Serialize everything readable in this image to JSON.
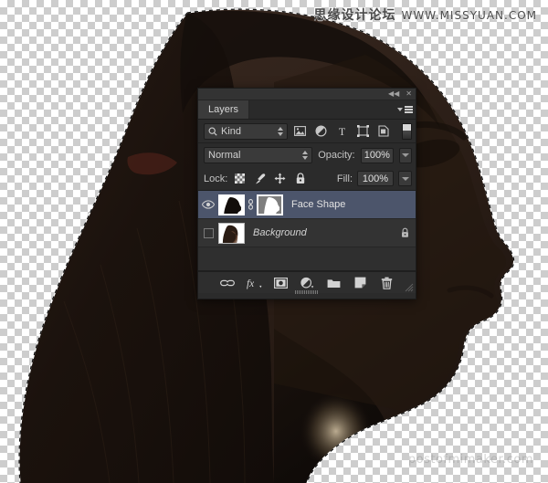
{
  "watermarks": {
    "top": "思缘设计论坛  WWW.MISSYUAN.COM",
    "top_cn": "思缘设计论坛",
    "top_url": "WWW.MISSYUAN.COM",
    "bottom": "postofmimaker.com"
  },
  "panel": {
    "titlebar": {
      "collapse_icon": "collapse-double-arrow",
      "collapse_glyph": "◀◀",
      "close_icon": "close-x",
      "close_glyph": "✕"
    },
    "tab": {
      "label": "Layers",
      "menu_icon": "panel-menu"
    },
    "filter_row": {
      "kind_label": "Kind",
      "search_icon": "magnifier-icon",
      "icons": [
        {
          "name": "filter-pixel-layers-icon",
          "title": "Pixel Layers"
        },
        {
          "name": "filter-adjustment-layers-icon",
          "title": "Adjustment Layers"
        },
        {
          "name": "filter-type-layers-icon",
          "title": "Type Layers",
          "glyph": "T"
        },
        {
          "name": "filter-shape-layers-icon",
          "title": "Shape Layers"
        },
        {
          "name": "filter-smart-objects-icon",
          "title": "Smart Objects"
        }
      ],
      "toggle_name": "filter-enable-toggle"
    },
    "blend_row": {
      "blend_mode": "Normal",
      "opacity_label": "Opacity:",
      "opacity_value": "100%"
    },
    "lock_row": {
      "lock_label": "Lock:",
      "fill_label": "Fill:",
      "fill_value": "100%",
      "lock_icons": [
        {
          "name": "lock-transparent-pixels-icon",
          "title": "Lock transparent pixels"
        },
        {
          "name": "lock-image-pixels-icon",
          "title": "Lock image pixels"
        },
        {
          "name": "lock-position-icon",
          "title": "Lock position"
        },
        {
          "name": "lock-all-icon",
          "title": "Lock all"
        }
      ]
    },
    "layers": [
      {
        "name": "Face Shape",
        "visible": true,
        "selected": true,
        "italic": false,
        "locked": false,
        "has_mask": true,
        "linked": true
      },
      {
        "name": "Background",
        "visible": false,
        "selected": false,
        "italic": true,
        "locked": true,
        "has_mask": false,
        "linked": false
      }
    ],
    "bottom_toolbar": [
      {
        "name": "link-layers-icon",
        "title": "Link layers"
      },
      {
        "name": "layer-style-fx-icon",
        "title": "Add a layer style",
        "glyph": "fx"
      },
      {
        "name": "add-layer-mask-icon",
        "title": "Add layer mask"
      },
      {
        "name": "new-adjustment-layer-icon",
        "title": "Create new fill or adjustment layer"
      },
      {
        "name": "new-group-icon",
        "title": "Create a new group"
      },
      {
        "name": "new-layer-icon",
        "title": "Create a new layer"
      },
      {
        "name": "delete-layer-icon",
        "title": "Delete layer"
      }
    ]
  },
  "colors": {
    "panel_bg": "#2b2b2b",
    "panel_tab_active": "#3b3b3b",
    "row_selected": "#4c556b",
    "row_normal": "#333333",
    "text": "#c9c9c9",
    "field_bg": "#3a3a3a",
    "silhouette": "#241a14",
    "checker": "#cdcdcd"
  },
  "canvas": {
    "subject": "woman-profile-silhouette",
    "selection": "marching-ants-selection-active"
  }
}
